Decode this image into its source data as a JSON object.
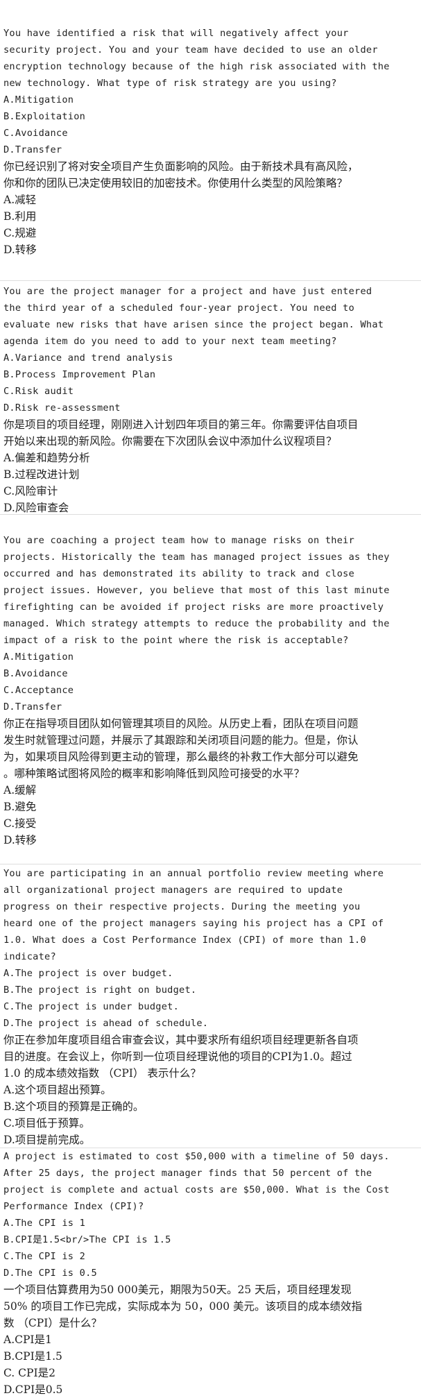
{
  "questions": [
    {
      "en_question_lines": [
        "You have identified a risk that will negatively affect your",
        "security project. You and your team have decided to use an older",
        "encryption technology because of the high risk associated with the",
        "new technology. What type of risk strategy are you using?"
      ],
      "en_options": [
        "A.Mitigation",
        "B.Exploitation",
        "C.Avoidance",
        "D.Transfer"
      ],
      "zh_question_lines": [
        "你已经识别了将对安全项目产生负面影响的风险。由于新技术具有高风险，",
        "你和你的团队已决定使用较旧的加密技术。你使用什么类型的风险策略？"
      ],
      "zh_options": [
        "A.减轻",
        "B.利用",
        "C.规避",
        "D.转移"
      ]
    },
    {
      "en_question_lines": [
        "You are the project manager for a project and have just entered",
        "the third year of a scheduled four-year project. You need to",
        "evaluate new risks that have arisen since the project began. What",
        "agenda item do you need to add to your next team meeting?"
      ],
      "en_options": [
        "A.Variance and trend analysis",
        "B.Process Improvement Plan",
        "C.Risk audit",
        "D.Risk re-assessment"
      ],
      "zh_question_lines": [
        "你是项目的项目经理，刚刚进入计划四年项目的第三年。你需要评估自项目",
        "开始以来出现的新风险。你需要在下次团队会议中添加什么议程项目？"
      ],
      "zh_options": [
        "A.偏差和趋势分析",
        "B.过程改进计划",
        "C.风险审计",
        "D.风险审查会"
      ]
    },
    {
      "en_question_lines": [
        "You are coaching a project team how to manage risks on their",
        "projects. Historically the team has managed project issues as they",
        "occurred and has demonstrated its ability to track and close",
        "project issues. However, you believe that most of this last minute",
        "firefighting can be avoided if project risks are more proactively",
        "managed. Which strategy attempts to reduce the probability and the",
        "impact of a risk to the point where the risk is acceptable?"
      ],
      "en_options": [
        "A.Mitigation",
        "B.Avoidance",
        "C.Acceptance",
        "D.Transfer"
      ],
      "zh_question_lines": [
        "你正在指导项目团队如何管理其项目的风险。从历史上看，团队在项目问题",
        "发生时就管理过问题，并展示了其跟踪和关闭项目问题的能力。但是，你认",
        "为，如果项目风险得到更主动的管理，那么最终的补救工作大部分可以避免",
        "。哪种策略试图将风险的概率和影响降低到风险可接受的水平？"
      ],
      "zh_options": [
        "A.缓解",
        "B.避免",
        "C.接受",
        "D.转移"
      ]
    },
    {
      "en_question_lines": [
        "You are participating in an annual portfolio review meeting where",
        "all organizational project managers are required to update",
        "progress on their respective projects. During the meeting you",
        "heard one of the project managers saying his project has a CPI of",
        "1.0. What does a Cost Performance Index (CPI) of more than 1.0",
        "indicate?"
      ],
      "en_options": [
        "A.The project is over budget.",
        "B.The project is right on budget.",
        "C.The project is under budget.",
        "D.The project is ahead of schedule."
      ],
      "zh_question_lines": [
        "你正在参加年度项目组合审查会议，其中要求所有组织项目经理更新各自项",
        "目的进度。在会议上，你听到一位项目经理说他的项目的CPI为1.0。超过",
        "1.0 的成本绩效指数 （CPI） 表示什么？"
      ],
      "zh_options": [
        "A.这个项目超出预算。",
        "B.这个项目的预算是正确的。",
        "C.项目低于预算。",
        "D.项目提前完成。"
      ]
    },
    {
      "en_question_lines": [
        "A project is estimated to cost $50,000 with a timeline of 50 days.",
        "After 25 days, the project manager finds that 50 percent of the",
        "project is complete and actual costs are $50,000. What is the Cost",
        "Performance Index (CPI)?"
      ],
      "en_options": [
        "A.The CPI is 1",
        "B.CPI是1.5<br/>The CPI is 1.5",
        "C.The CPI is 2",
        "D.The CPI is 0.5"
      ],
      "zh_question_lines": [
        "一个项目估算费用为50 000美元，期限为50天。25 天后，项目经理发现",
        "50% 的项目工作已完成，实际成本为 50，000 美元。该项目的成本绩效指",
        "数 （CPI）是什么？"
      ],
      "zh_options": [
        "A.CPI是1",
        "B.CPI是1.5",
        "C. CPI是2",
        "D.CPI是0.5"
      ]
    }
  ]
}
